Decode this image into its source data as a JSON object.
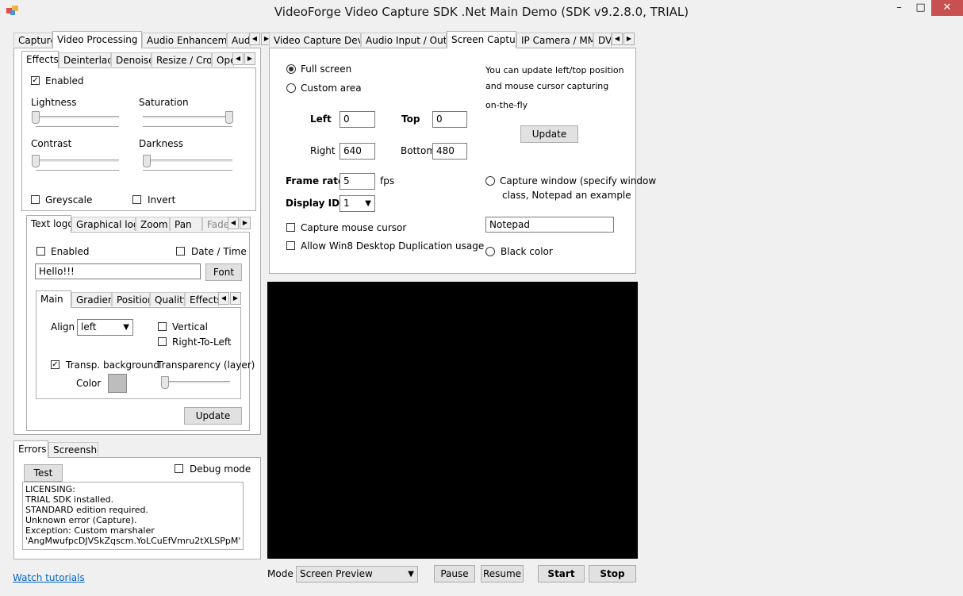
{
  "window": {
    "title": "VideoForge Video Capture SDK .Net Main Demo (SDK v9.2.8.0, TRIAL)"
  },
  "controls": {
    "minimize": "–",
    "maximize": "□",
    "close": "✕"
  },
  "left_tabs": [
    "Capture",
    "Video Processing",
    "Audio Enhancement",
    "Audi"
  ],
  "vp_tabs": [
    "Effects",
    "Deinterlace",
    "Denoise",
    "Resize / Crop",
    "Ope"
  ],
  "effects": {
    "enabled_label": "Enabled",
    "enabled": true,
    "lightness_label": "Lightness",
    "saturation_label": "Saturation",
    "contrast_label": "Contrast",
    "darkness_label": "Darkness",
    "lightness": 0,
    "saturation": 1,
    "contrast": 0,
    "darkness": 0,
    "greyscale_label": "Greyscale",
    "invert_label": "Invert"
  },
  "logo_tabs": [
    "Text logo",
    "Graphical logo",
    "Zoom",
    "Pan",
    "Fade"
  ],
  "textlogo": {
    "enabled_label": "Enabled",
    "datetime_label": "Date / Time",
    "text_value": "Hello!!!",
    "font_button": "Font"
  },
  "inner_tabs": [
    "Main",
    "Gradient",
    "Position",
    "Quality",
    "Effects"
  ],
  "main_tab": {
    "align_label": "Align",
    "align_value": "left",
    "vertical_label": "Vertical",
    "rtl_label": "Right-To-Left",
    "transp_label": "Transp. background",
    "transp_checked": true,
    "transparency_label": "Transparency (layer)",
    "transparency": 0,
    "color_label": "Color",
    "color_value": "#bdbdbd",
    "update_button": "Update"
  },
  "bottom_tabs": [
    "Errors",
    "Screenshot"
  ],
  "errors": {
    "test_button": "Test",
    "debug_label": "Debug mode",
    "log": "LICENSING:\nTRIAL SDK installed.\nSTANDARD edition required.\nUnknown error (Capture).\nException: Custom marshaler\n'AngMwufpcDJVSkZqscm.YoLCuEfVmru2tXLSPpM' does"
  },
  "watch_tutorials": "Watch tutorials",
  "right_tabs": [
    "Video Capture Device",
    "Audio Input / Output",
    "Screen Capture",
    "IP Camera / MMS",
    "DVI"
  ],
  "screen": {
    "fullscreen_label": "Full screen",
    "customarea_label": "Custom area",
    "left_label": "Left",
    "left_value": "0",
    "top_label": "Top",
    "top_value": "0",
    "right_label": "Right",
    "right_value": "640",
    "bottom_label": "Bottom",
    "bottom_value": "480",
    "framerate_label": "Frame rate",
    "framerate_value": "5",
    "fps_label": "fps",
    "displayid_label": "Display ID",
    "displayid_value": "1",
    "mouse_label": "Capture mouse cursor",
    "win8_label": "Allow Win8 Desktop Duplication usage",
    "note_line1": "You can update left/top position",
    "note_line2": "and mouse cursor  capturing",
    "note_line3": "on-the-fly",
    "update_button": "Update",
    "capwin_line1": "Capture window (specify window",
    "capwin_line2": "class, Notepad an example",
    "window_class_value": "Notepad",
    "black_label": "Black color"
  },
  "bottom_bar": {
    "mode_label": "Mode",
    "mode_value": "Screen Preview",
    "pause": "Pause",
    "resume": "Resume",
    "start": "Start",
    "stop": "Stop"
  }
}
